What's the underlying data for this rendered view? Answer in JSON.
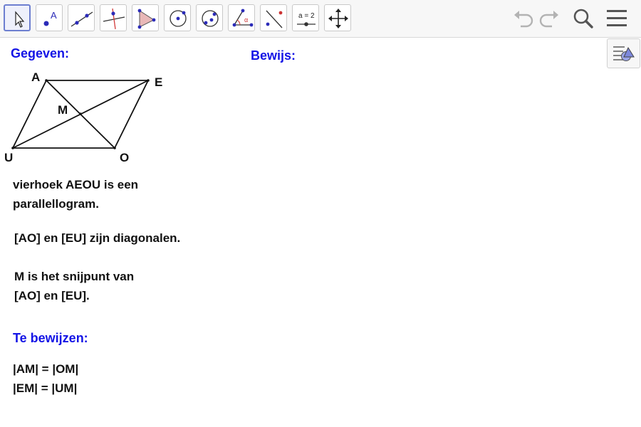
{
  "toolbar": {
    "tools": [
      {
        "name": "move-tool"
      },
      {
        "name": "point-tool",
        "glyph": "A"
      },
      {
        "name": "line-tool"
      },
      {
        "name": "perpendicular-line-tool"
      },
      {
        "name": "polygon-tool"
      },
      {
        "name": "circle-tool"
      },
      {
        "name": "ellipse-tool"
      },
      {
        "name": "angle-tool",
        "glyph": "α"
      },
      {
        "name": "reflect-tool"
      },
      {
        "name": "slider-tool",
        "glyph": "a = 2"
      },
      {
        "name": "move-graphics-view-tool"
      }
    ]
  },
  "headings": {
    "given": "Gegeven:",
    "proof": "Bewijs:",
    "to_prove": "Te bewijzen:"
  },
  "figure": {
    "labels": {
      "A": "A",
      "E": "E",
      "U": "U",
      "O": "O",
      "M": "M"
    }
  },
  "given_text": {
    "line1": "vierhoek AEOU is een",
    "line2": "parallellogram.",
    "line3": "[AO] en [EU] zijn diagonalen.",
    "line4": "M is het snijpunt van",
    "line5": "[AO] en [EU]."
  },
  "to_prove_text": {
    "line1": "|AM| = |OM|",
    "line2": "|EM| = |UM|"
  },
  "colors": {
    "heading": "#1414e6",
    "text": "#111111",
    "accent": "#6d7fd0"
  }
}
